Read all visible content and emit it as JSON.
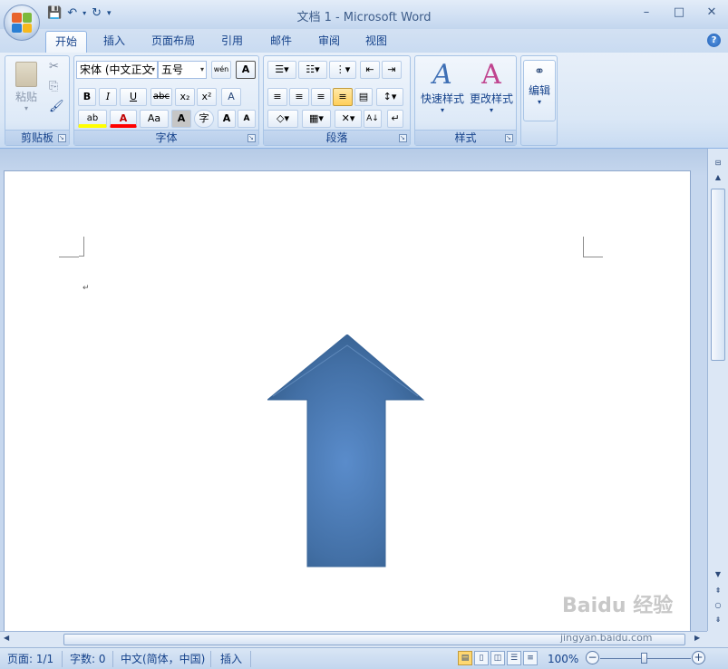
{
  "title_bar": {
    "title": "文档 1 - Microsoft Word",
    "minimize": "–",
    "maximize": "□",
    "close": "✕"
  },
  "qat": {
    "save": "💾",
    "undo": "↶",
    "redo": "↻",
    "customize": "▾"
  },
  "tabs": [
    {
      "label": "开始",
      "active": true
    },
    {
      "label": "插入"
    },
    {
      "label": "页面布局"
    },
    {
      "label": "引用"
    },
    {
      "label": "邮件"
    },
    {
      "label": "审阅"
    },
    {
      "label": "视图"
    }
  ],
  "help_label": "?",
  "ribbon": {
    "clipboard": {
      "label": "剪贴板",
      "paste": "粘贴",
      "cut": "✂",
      "copy": "⎘",
      "format_painter": "🖌"
    },
    "font": {
      "label": "字体",
      "font_name": "宋体 (中文正文",
      "font_size": "五号",
      "phonetic": "wén",
      "char_border": "A",
      "bold": "B",
      "italic": "I",
      "underline": "U",
      "strike": "abc",
      "subscript": "x₂",
      "superscript": "x²",
      "clear_format": "A",
      "highlight": "ab",
      "font_color": "A",
      "change_case": "Aa",
      "char_shading": "A",
      "enclose": "字",
      "grow": "A",
      "shrink": "A"
    },
    "paragraph": {
      "label": "段落"
    },
    "styles": {
      "label": "样式",
      "quick_styles": "快速样式",
      "change_styles": "更改样式"
    },
    "editing": {
      "label": "编辑",
      "find": "编辑"
    }
  },
  "document": {
    "paragraph_mark": "↵",
    "shape": "up-arrow",
    "shape_color": "#4370a6"
  },
  "status_bar": {
    "page": "页面: 1/1",
    "words": "字数: 0",
    "language": "中文(简体，中国)",
    "mode": "插入",
    "zoom": "100%",
    "zoom_level_percent": 100
  },
  "watermark": {
    "main": "Baidu 经验",
    "url": "jingyan.baidu.com"
  }
}
